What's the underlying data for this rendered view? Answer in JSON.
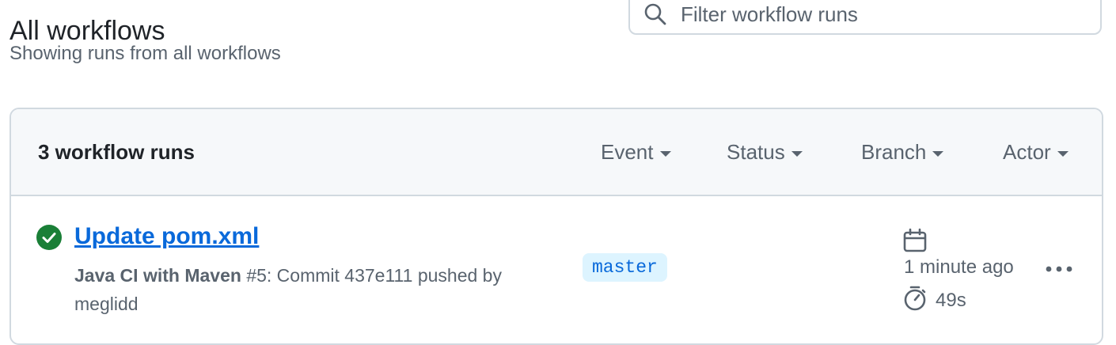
{
  "header": {
    "title": "All workflows",
    "subtitle": "Showing runs from all workflows"
  },
  "search": {
    "placeholder": "Filter workflow runs",
    "icon": "search-icon"
  },
  "runs": {
    "count_label": "3 workflow runs",
    "filters": [
      {
        "label": "Event"
      },
      {
        "label": "Status"
      },
      {
        "label": "Branch"
      },
      {
        "label": "Actor"
      }
    ],
    "items": [
      {
        "status": "success",
        "status_icon": "check-circle-fill-icon",
        "status_color": "#1a7f37",
        "title": "Update pom.xml",
        "workflow_name": "Java CI with Maven",
        "run_number": "#5",
        "description": ": Commit 437e111 pushed by",
        "actor": "meglidd",
        "branch": "master",
        "time_ago": "1 minute ago",
        "duration": "49s"
      }
    ]
  },
  "colors": {
    "link": "#0969da",
    "muted_text": "#59636e",
    "border": "#d1d9e0",
    "header_bg": "#f6f8fa",
    "branch_bg": "#ddf4ff"
  }
}
